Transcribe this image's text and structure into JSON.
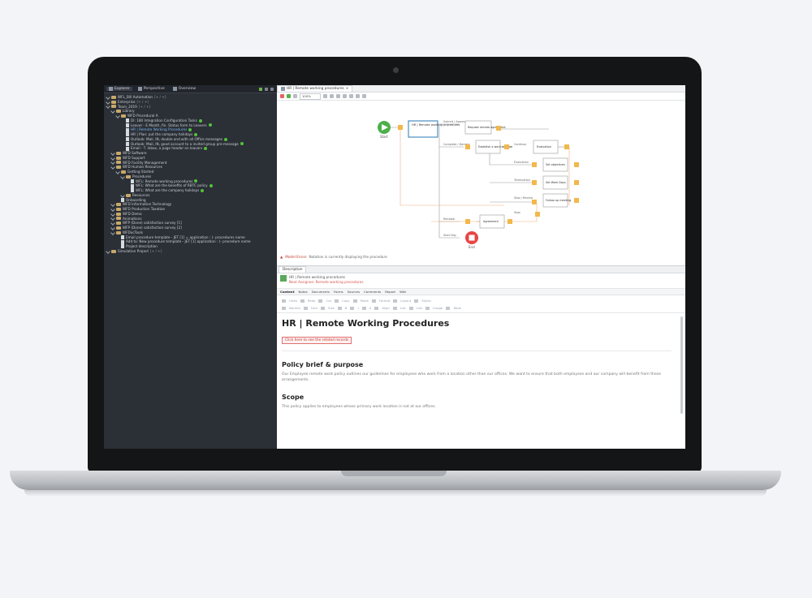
{
  "explorer": {
    "tabs": [
      {
        "label": "Explorer"
      },
      {
        "label": "Perspective"
      },
      {
        "label": "Overview"
      }
    ],
    "tree": [
      {
        "depth": 0,
        "label": "WFL_Bill Automation",
        "suffix": "[+ / +] ",
        "type": "folder"
      },
      {
        "depth": 0,
        "label": "Enterprise",
        "suffix": "[+ / +]",
        "type": "folder"
      },
      {
        "depth": 0,
        "label": "Team_2019",
        "suffix": "[+ / +]",
        "type": "folder"
      },
      {
        "depth": 1,
        "label": "Library",
        "type": "folder"
      },
      {
        "depth": 2,
        "label": "WFD Procedural A",
        "type": "folder"
      },
      {
        "depth": 3,
        "label": "DI: 180 Integration Configuration Tasks",
        "type": "doc",
        "badge": true
      },
      {
        "depth": 3,
        "label": "Leaver - E Month, fin. Status form to Leavers",
        "type": "doc",
        "badge": true
      },
      {
        "depth": 3,
        "label": "HR | Remote Working Procedures",
        "type": "doc",
        "highlight": true,
        "badge": true
      },
      {
        "depth": 3,
        "label": "HR | Plan: put the company holidays",
        "type": "doc",
        "badge": true
      },
      {
        "depth": 3,
        "label": "Outlook: Mail, IN, double and with all Office messages",
        "type": "doc",
        "badge": true
      },
      {
        "depth": 3,
        "label": "Outlook: Mail, IN, good account to a invited group pre-message",
        "type": "doc",
        "badge": true
      },
      {
        "depth": 3,
        "label": "Email - T. Inbox, a page header on leavers",
        "type": "doc",
        "badge": true
      },
      {
        "depth": 1,
        "label": "WFD Software",
        "type": "folder"
      },
      {
        "depth": 1,
        "label": "WFD Support",
        "type": "folder"
      },
      {
        "depth": 1,
        "label": "WFD Facility Management",
        "type": "folder"
      },
      {
        "depth": 1,
        "label": "WFD Human Resources",
        "type": "folder"
      },
      {
        "depth": 2,
        "label": "Getting Started",
        "type": "folder"
      },
      {
        "depth": 3,
        "label": "Procedures",
        "type": "folder"
      },
      {
        "depth": 4,
        "label": "WFL: Remote working procedures",
        "type": "doc",
        "badge": true
      },
      {
        "depth": 4,
        "label": "WFL: What are the benefits of RBTC policy",
        "type": "doc",
        "badge": true
      },
      {
        "depth": 4,
        "label": "WFL: What are the company holidays",
        "type": "doc",
        "badge": true
      },
      {
        "depth": 3,
        "label": "Resources",
        "type": "folder"
      },
      {
        "depth": 2,
        "label": "Onboarding",
        "type": "doc"
      },
      {
        "depth": 1,
        "label": "WFD Information Technology",
        "type": "folder"
      },
      {
        "depth": 1,
        "label": "WFD Production Taxation",
        "type": "folder"
      },
      {
        "depth": 1,
        "label": "WFD Demo",
        "type": "folder"
      },
      {
        "depth": 1,
        "label": "Animations",
        "type": "folder"
      },
      {
        "depth": 1,
        "label": "WFP (Done) satisfaction survey [1]",
        "type": "folder"
      },
      {
        "depth": 1,
        "label": "WFP (Done) satisfaction survey [2]",
        "type": "folder"
      },
      {
        "depth": 1,
        "label": "WFDocTools",
        "type": "folder"
      },
      {
        "depth": 2,
        "label": "Email procedure template - JET [1] = application : (- procedures name",
        "type": "doc"
      },
      {
        "depth": 2,
        "label": "Add to: New procedure template - JET [1] application : (- procedure name",
        "type": "doc"
      },
      {
        "depth": 2,
        "label": "Project description",
        "type": "doc"
      },
      {
        "depth": 0,
        "label": "Simulation Project",
        "suffix": "[+ / +]",
        "type": "folder"
      }
    ]
  },
  "editor": {
    "tab_label": "HR | Remote working procedures",
    "zoom": "100%",
    "diagram": {
      "start_label": "Start",
      "end_label": "End",
      "task1": "HR | Remote working procedures",
      "gate_labels": [
        "Submit / Approve",
        "Complete / Denied",
        "Start Day"
      ],
      "nodes": [
        "Request remote agreement",
        "Establish a work location",
        "Evaluation",
        "Set objectives",
        "Set Work Days",
        "Follow-up meeting",
        "Evaluation",
        "Agreement"
      ],
      "branch_labels": [
        "Continue",
        "Evaluation",
        "Termination",
        "Stop / Review",
        "Stop",
        "Renewal"
      ]
    },
    "status_error": "Model Errors",
    "status_text": "Notation is currently displaying the procedure"
  },
  "description": {
    "tab_label": "Description",
    "item_name": "HR | Remote working procedures",
    "item_error": "Next Assignee: Remote working procedures",
    "subtabs": [
      "Content",
      "Notes",
      "Documents",
      "Forms",
      "Sources",
      "Comments",
      "Report",
      "Wiki"
    ],
    "toolbar_rows": [
      [
        "Undo",
        "Redo",
        "Cut",
        "Copy",
        "Paste",
        "Format",
        "Layout",
        "Styles"
      ],
      [
        "Normal",
        "Font",
        "Size",
        "B",
        "I",
        "U",
        "Align",
        "List",
        "Link",
        "Image",
        "Table"
      ]
    ],
    "doc": {
      "title": "HR | Remote Working Procedures",
      "warning": "Click here to see the related records",
      "h_policy": "Policy brief & purpose",
      "p_policy": "Our Employee remote work policy outlines our guidelines for employees who work from a location other than our offices. We want to ensure that both employees and our company will benefit from these arrangements.",
      "h_scope": "Scope",
      "p_scope": "This policy applies to employees whose primary work location is not at our offices."
    }
  }
}
